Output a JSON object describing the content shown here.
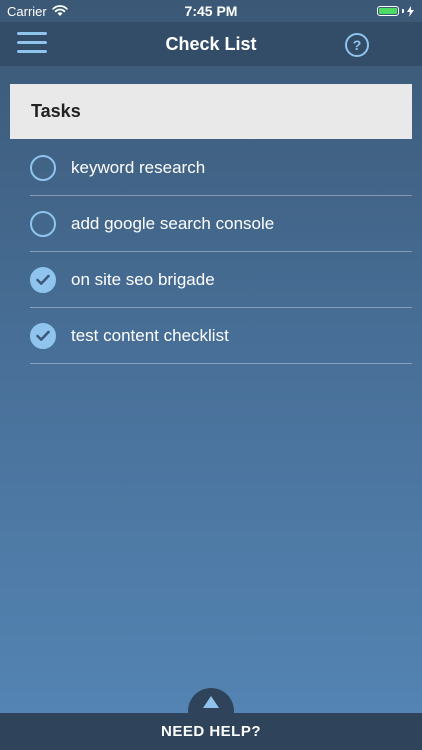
{
  "status_bar": {
    "carrier": "Carrier",
    "time": "7:45 PM"
  },
  "nav": {
    "title": "Check List",
    "help_symbol": "?",
    "menu_icon": "hamburger-menu-icon",
    "help_icon": "question-circle-icon"
  },
  "section": {
    "title": "Tasks"
  },
  "tasks": [
    {
      "label": "keyword research",
      "done": false
    },
    {
      "label": "add google search console",
      "done": false
    },
    {
      "label": "on site seo brigade",
      "done": true
    },
    {
      "label": "test content checklist",
      "done": true
    }
  ],
  "footer": {
    "label": "NEED HELP?"
  },
  "colors": {
    "accent": "#8fc4ee",
    "nav_background": "#334d68",
    "footer_background": "#2f445a",
    "section_background": "#e9e9ea",
    "battery": "#4cd964"
  }
}
